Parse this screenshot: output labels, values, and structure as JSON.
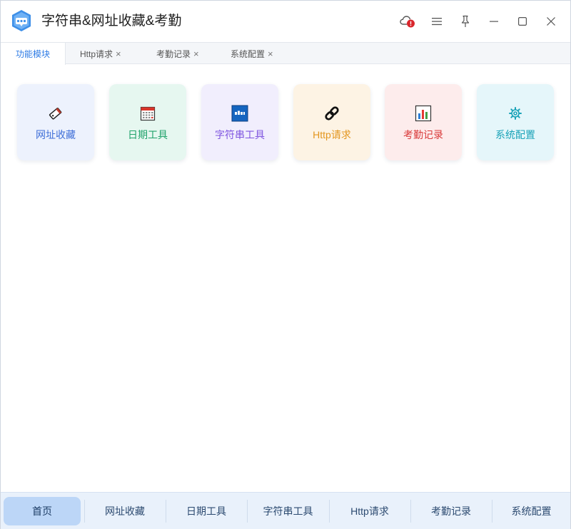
{
  "window": {
    "title": "字符串&网址收藏&考勤"
  },
  "tabs": [
    {
      "label": "功能模块",
      "closable": false,
      "active": true
    },
    {
      "label": "Http请求",
      "closable": true,
      "active": false
    },
    {
      "label": "考勤记录",
      "closable": true,
      "active": false
    },
    {
      "label": "系统配置",
      "closable": true,
      "active": false
    }
  ],
  "tab_close_glyph": "×",
  "modules": [
    {
      "label": "网址收藏",
      "icon": "bookmark-tag-icon",
      "bg": "#edf2fd",
      "color": "#3f6fd8"
    },
    {
      "label": "日期工具",
      "icon": "calendar-icon",
      "bg": "#e6f7f0",
      "color": "#21a36b"
    },
    {
      "label": "字符串工具",
      "icon": "abc-text-icon",
      "bg": "#f1eefd",
      "color": "#7f55e0"
    },
    {
      "label": "Http请求",
      "icon": "link-chain-icon",
      "bg": "#fdf3e4",
      "color": "#e3961f"
    },
    {
      "label": "考勤记录",
      "icon": "bar-chart-icon",
      "bg": "#fdecec",
      "color": "#d93a3a"
    },
    {
      "label": "系统配置",
      "icon": "gear-icon",
      "bg": "#e5f6fa",
      "color": "#1aa3b8"
    }
  ],
  "bottom_nav": [
    {
      "label": "首页",
      "active": true
    },
    {
      "label": "网址收藏",
      "active": false
    },
    {
      "label": "日期工具",
      "active": false
    },
    {
      "label": "字符串工具",
      "active": false
    },
    {
      "label": "Http请求",
      "active": false
    },
    {
      "label": "考勤记录",
      "active": false
    },
    {
      "label": "系统配置",
      "active": false
    }
  ],
  "colors": {
    "accent": "#2d7be5",
    "cloud_alert": "#d9262c",
    "nav_bg": "#e9f1fb",
    "nav_active": "#bcd6f7"
  }
}
